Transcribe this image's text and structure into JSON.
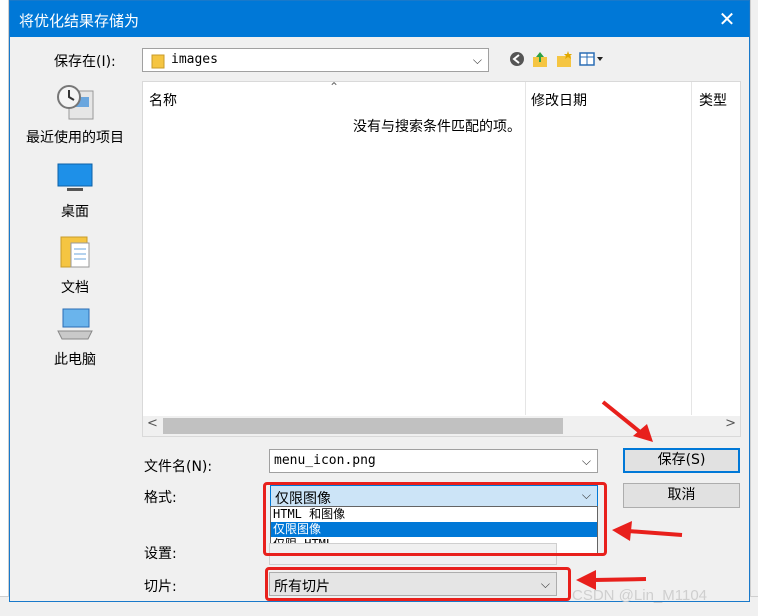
{
  "dialog": {
    "title": "将优化结果存储为",
    "close_glyph": "✕"
  },
  "save_in": {
    "label": "保存在(I):",
    "value": "images"
  },
  "places": [
    {
      "label": "最近使用的项目",
      "icon": "recent-items-icon"
    },
    {
      "label": "桌面",
      "icon": "desktop-icon"
    },
    {
      "label": "文档",
      "icon": "documents-icon"
    },
    {
      "label": "此电脑",
      "icon": "this-pc-icon"
    }
  ],
  "file_list": {
    "columns": [
      "名称",
      "修改日期",
      "类型"
    ],
    "empty_message": "没有与搜索条件匹配的项。"
  },
  "file_name": {
    "label": "文件名(N):",
    "value": "menu_icon.png"
  },
  "format": {
    "label": "格式:",
    "value": "仅限图像",
    "options": [
      "HTML 和图像",
      "仅限图像",
      "仅限 HTML"
    ],
    "selected_index": 1
  },
  "settings": {
    "label": "设置:"
  },
  "slices": {
    "label": "切片:",
    "value": "所有切片"
  },
  "buttons": {
    "save": "保存(S)",
    "cancel": "取消"
  },
  "watermark": "CSDN @Lin_M1104",
  "colors": {
    "titlebar": "#0078d7",
    "annotation": "#e8201c",
    "selection": "#0078d7"
  }
}
